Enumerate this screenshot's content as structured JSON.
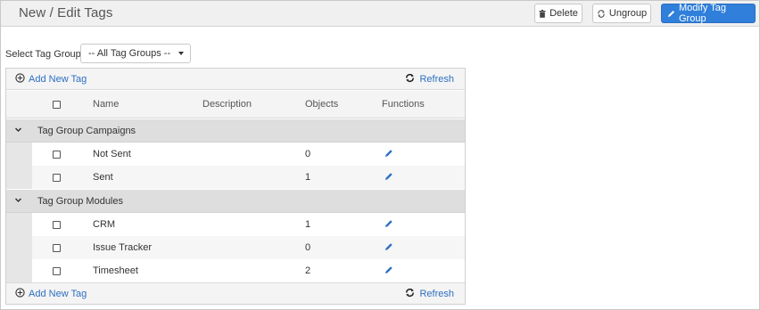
{
  "header": {
    "title": "New / Edit Tags",
    "delete_label": "Delete",
    "ungroup_label": "Ungroup",
    "modify_label": "Modify Tag Group"
  },
  "filter": {
    "label": "Select Tag Group",
    "selected": "-- All Tag Groups --"
  },
  "toolbar": {
    "add_label": "Add New Tag",
    "refresh_label": "Refresh"
  },
  "columns": {
    "name": "Name",
    "description": "Description",
    "objects": "Objects",
    "functions": "Functions"
  },
  "groups": [
    {
      "title": "Tag Group Campaigns",
      "rows": [
        {
          "name": "Not Sent",
          "objects": "0"
        },
        {
          "name": "Sent",
          "objects": "1"
        }
      ]
    },
    {
      "title": "Tag Group Modules",
      "rows": [
        {
          "name": "CRM",
          "objects": "1"
        },
        {
          "name": "Issue Tracker",
          "objects": "0"
        },
        {
          "name": "Timesheet",
          "objects": "2"
        }
      ]
    }
  ],
  "colors": {
    "accent": "#2f7fdb",
    "link": "#2d6fc2",
    "group_row": "#dedede"
  }
}
